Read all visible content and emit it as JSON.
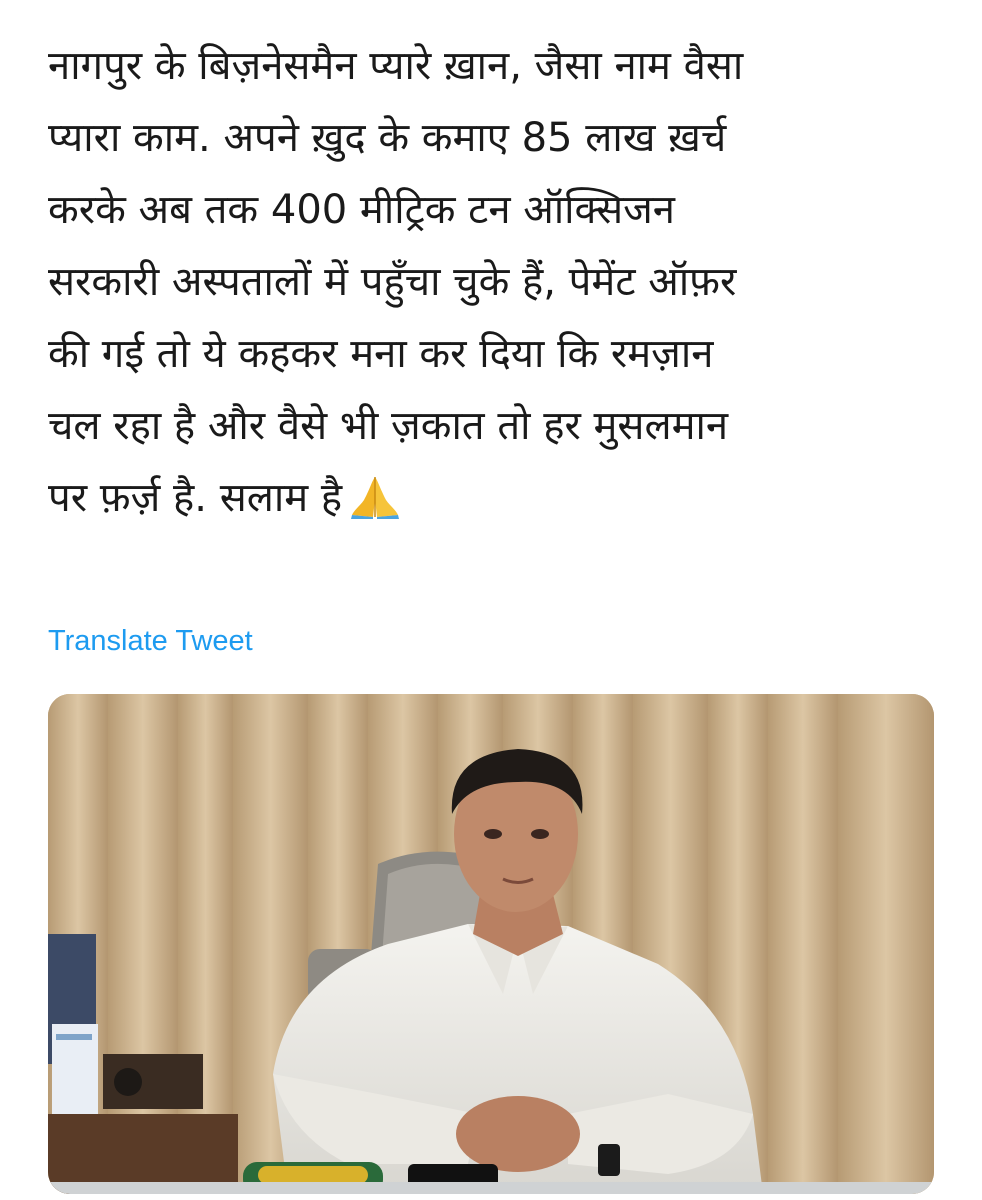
{
  "tweet": {
    "text_lines": [
      "नागपुर के बिज़नेसमैन प्यारे ख़ान, जैसा नाम वैसा",
      "प्यारा काम. अपने ख़ुद के कमाए 85 लाख ख़र्च",
      "करके अब तक 400 मीट्रिक टन ऑक्सिजन",
      "सरकारी अस्पतालों में पहुँचा चुके हैं, पेमेंट ऑफ़र",
      "की गई तो ये कहकर मना कर दिया कि रमज़ान",
      "चल रहा है और वैसे भी ज़कात तो हर मुसलमान",
      "पर फ़र्ज़ है. सलाम है"
    ],
    "emoji_icon": "folded-hands-icon",
    "translate_label": "Translate Tweet"
  },
  "colors": {
    "text": "#1a1a1a",
    "link": "#1d9bf0",
    "background": "#ffffff"
  },
  "media": {
    "description_icon": "photo-man-in-white-shirt-at-desk"
  }
}
